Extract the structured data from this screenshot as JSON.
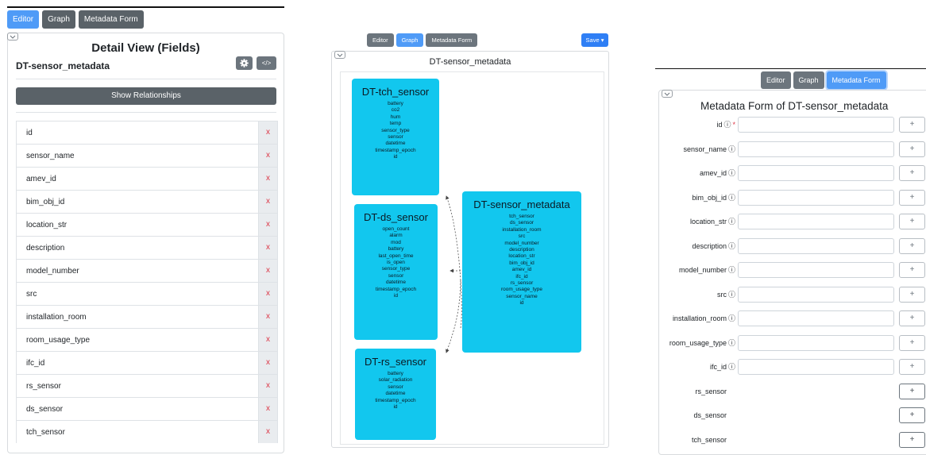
{
  "editor": {
    "tabs": [
      {
        "label": "Editor",
        "active": true
      },
      {
        "label": "Graph",
        "active": false
      },
      {
        "label": "Metadata Form",
        "active": false
      }
    ],
    "title": "Detail View (Fields)",
    "entity_name": "DT-sensor_metadata",
    "gear_icon": "gear-icon",
    "code_label": "</>",
    "show_relationships_label": "Show Relationships",
    "delete_label": "x",
    "fields": [
      "id",
      "sensor_name",
      "amev_id",
      "bim_obj_id",
      "location_str",
      "description",
      "model_number",
      "src",
      "installation_room",
      "room_usage_type",
      "ifc_id",
      "rs_sensor",
      "ds_sensor",
      "tch_sensor"
    ]
  },
  "graph": {
    "tabs": [
      {
        "label": "Editor",
        "active": false
      },
      {
        "label": "Graph",
        "active": true
      },
      {
        "label": "Metadata Form",
        "active": false
      }
    ],
    "save_label": "Save ▾",
    "title": "DT-sensor_metadata",
    "nodes": [
      {
        "title": "DT-tch_sensor",
        "fields": [
          "battery",
          "co2",
          "hum",
          "temp",
          "sensor_type",
          "sensor",
          "datetime",
          "timestamp_epoch",
          "id"
        ]
      },
      {
        "title": "DT-ds_sensor",
        "fields": [
          "open_count",
          "alarm",
          "mod",
          "battery",
          "last_open_time",
          "is_open",
          "sensor_type",
          "sensor",
          "datetime",
          "timestamp_epoch",
          "id"
        ]
      },
      {
        "title": "DT-rs_sensor",
        "fields": [
          "battery",
          "solar_radiation",
          "sensor",
          "datetime",
          "timestamp_epoch",
          "id"
        ]
      },
      {
        "title": "DT-sensor_metadata",
        "fields": [
          "tch_sensor",
          "ds_sensor",
          "installation_room",
          "src",
          "model_number",
          "description",
          "location_str",
          "bim_obj_id",
          "amev_id",
          "ifc_id",
          "rs_sensor",
          "room_usage_type",
          "sensor_name",
          "id"
        ]
      }
    ],
    "node_color": "#12c7ee"
  },
  "form": {
    "tabs": [
      {
        "label": "Editor",
        "active": false
      },
      {
        "label": "Graph",
        "active": false
      },
      {
        "label": "Metadata Form",
        "active": true
      }
    ],
    "title": "Metadata Form of DT-sensor_metadata",
    "info_icon": "ⓘ",
    "required_mark": "*",
    "plus_label": "+",
    "rows": [
      {
        "label": "id",
        "info": true,
        "required": true,
        "input": true
      },
      {
        "label": "sensor_name",
        "info": true,
        "required": false,
        "input": true
      },
      {
        "label": "amev_id",
        "info": true,
        "required": false,
        "input": true
      },
      {
        "label": "bim_obj_id",
        "info": true,
        "required": false,
        "input": true
      },
      {
        "label": "location_str",
        "info": true,
        "required": false,
        "input": true
      },
      {
        "label": "description",
        "info": true,
        "required": false,
        "input": true
      },
      {
        "label": "model_number",
        "info": true,
        "required": false,
        "input": true
      },
      {
        "label": "src",
        "info": true,
        "required": false,
        "input": true
      },
      {
        "label": "installation_room",
        "info": true,
        "required": false,
        "input": true
      },
      {
        "label": "room_usage_type",
        "info": true,
        "required": false,
        "input": true
      },
      {
        "label": "ifc_id",
        "info": true,
        "required": false,
        "input": true
      },
      {
        "label": "rs_sensor",
        "info": false,
        "required": false,
        "input": false
      },
      {
        "label": "ds_sensor",
        "info": false,
        "required": false,
        "input": false
      },
      {
        "label": "tch_sensor",
        "info": false,
        "required": false,
        "input": false
      }
    ]
  },
  "colors": {
    "active_tab": "#4f9bf7",
    "inactive_tab": "#6c757d",
    "delete_x": "#dc3545",
    "required": "#dc3545"
  }
}
